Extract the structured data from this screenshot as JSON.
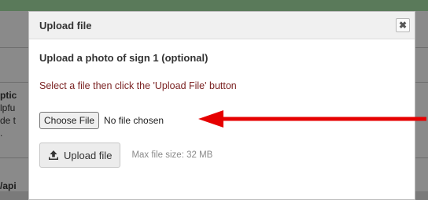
{
  "background": {
    "fragments": [
      "ptic",
      "lpfu",
      "de t",
      ".",
      "/api"
    ]
  },
  "modal": {
    "title": "Upload file",
    "close_icon": "close-icon",
    "heading": "Upload a photo of sign 1 (optional)",
    "instruction": "Select a file then click the 'Upload File' button",
    "choose_file_label": "Choose File",
    "no_file_text": "No file chosen",
    "upload_button_label": "Upload file",
    "upload_icon": "upload-icon",
    "max_size_text": "Max file size: 32 MB"
  },
  "colors": {
    "instruction": "#7b2323",
    "arrow": "#e60000",
    "overlay": "#8a8a8a"
  }
}
